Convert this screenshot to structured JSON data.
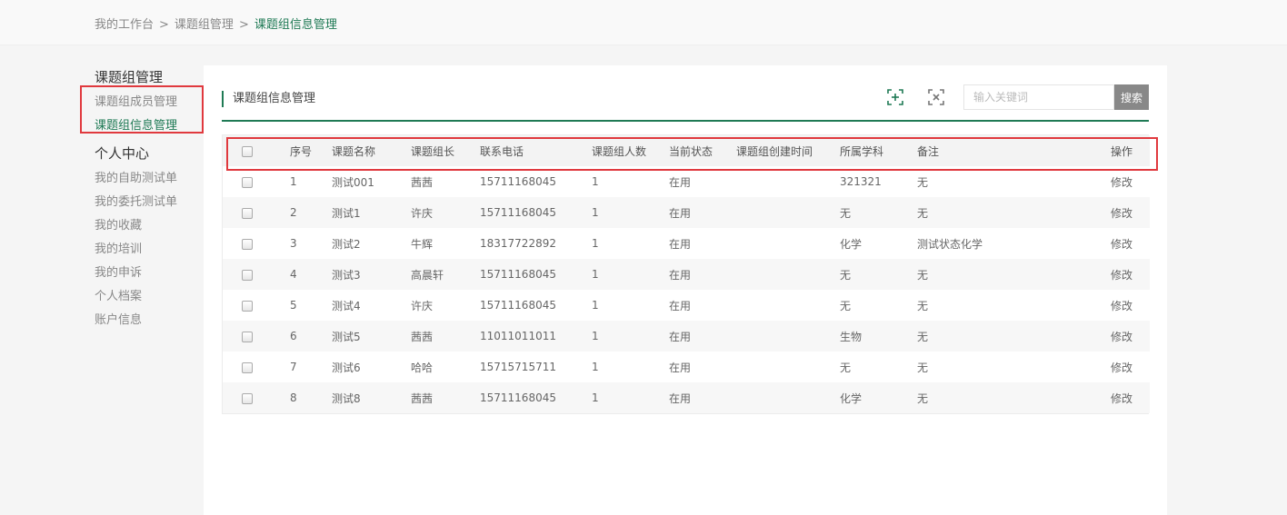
{
  "breadcrumb": {
    "items": [
      "我的工作台",
      "课题组管理",
      "课题组信息管理"
    ],
    "separator": ">"
  },
  "sidebar": {
    "section1_title": "课题组管理",
    "section1_items": [
      "课题组成员管理",
      "课题组信息管理"
    ],
    "section2_title": "个人中心",
    "section2_items": [
      "我的自助测试单",
      "我的委托测试单",
      "我的收藏",
      "我的培训",
      "我的申诉",
      "个人档案",
      "账户信息"
    ]
  },
  "panel": {
    "title": "课题组信息管理",
    "search_placeholder": "输入关键词",
    "search_button": "搜索",
    "icons": [
      "expand-icon",
      "collapse-icon"
    ]
  },
  "table": {
    "headers": [
      "序号",
      "课题名称",
      "课题组长",
      "联系电话",
      "课题组人数",
      "当前状态",
      "课题组创建时间",
      "所属学科",
      "备注",
      "操作"
    ],
    "rows": [
      [
        "1",
        "测试001",
        "茜茜",
        "15711168045",
        "1",
        "在用",
        "",
        "321321",
        "无",
        "修改"
      ],
      [
        "2",
        "测试1",
        "许庆",
        "15711168045",
        "1",
        "在用",
        "",
        "无",
        "无",
        "修改"
      ],
      [
        "3",
        "测试2",
        "牛辉",
        "18317722892",
        "1",
        "在用",
        "",
        "化学",
        "测试状态化学",
        "修改"
      ],
      [
        "4",
        "测试3",
        "高晨轩",
        "15711168045",
        "1",
        "在用",
        "",
        "无",
        "无",
        "修改"
      ],
      [
        "5",
        "测试4",
        "许庆",
        "15711168045",
        "1",
        "在用",
        "",
        "无",
        "无",
        "修改"
      ],
      [
        "6",
        "测试5",
        "茜茜",
        "11011011011",
        "1",
        "在用",
        "",
        "生物",
        "无",
        "修改"
      ],
      [
        "7",
        "测试6",
        "哈哈",
        "15715715711",
        "1",
        "在用",
        "",
        "无",
        "无",
        "修改"
      ],
      [
        "8",
        "测试8",
        "茜茜",
        "15711168045",
        "1",
        "在用",
        "",
        "化学",
        "无",
        "修改"
      ]
    ]
  },
  "colors": {
    "accent": "#1f7a55",
    "highlight_box": "#e0393e",
    "search_button_bg": "#888888"
  }
}
